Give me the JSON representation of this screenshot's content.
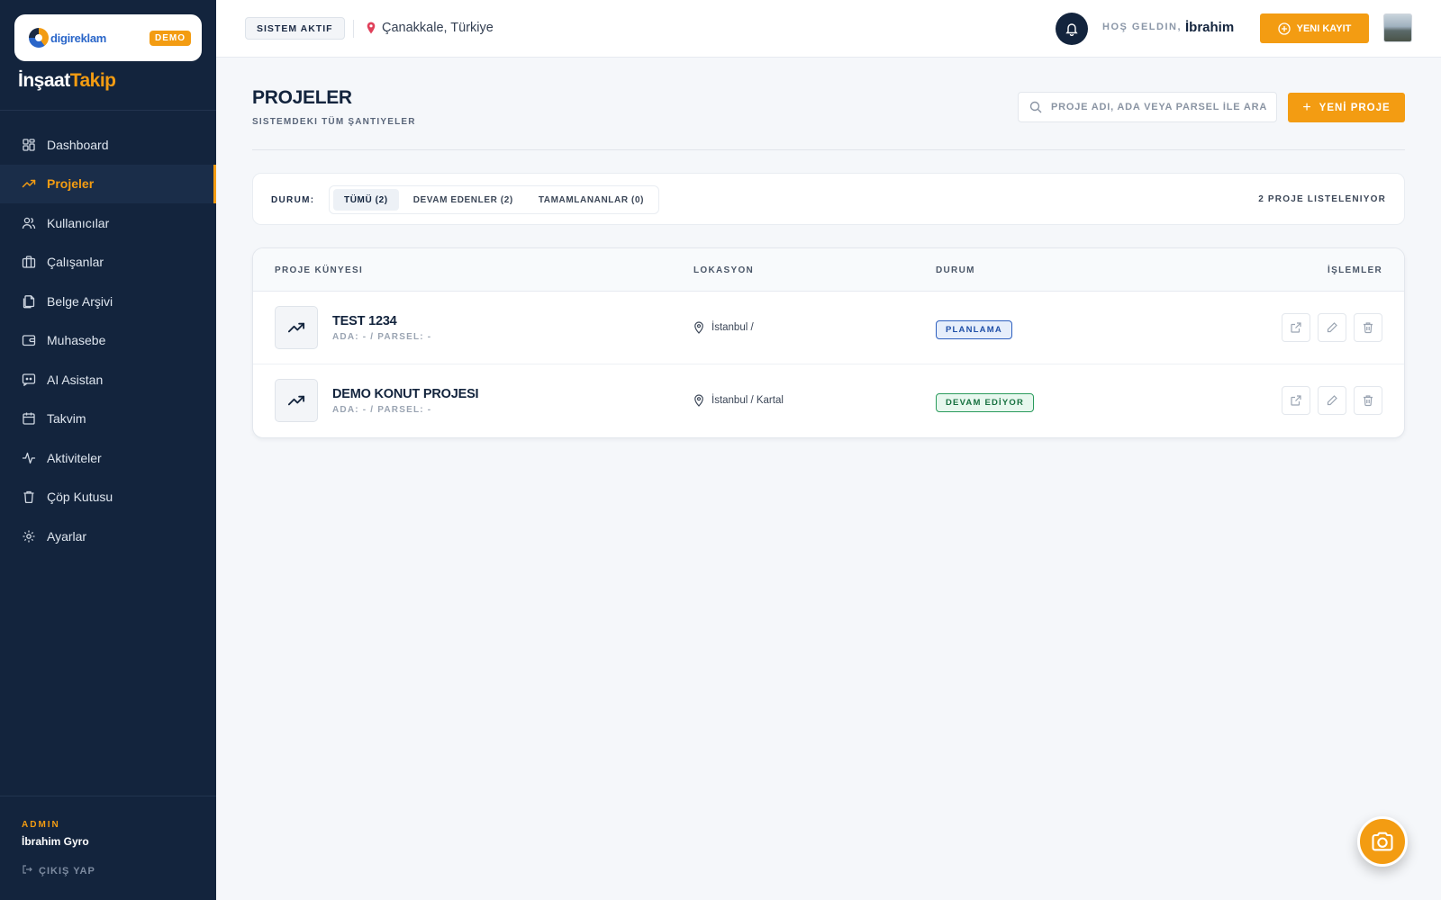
{
  "brand": {
    "logo_text": "digireklam",
    "badge": "DEMO",
    "app_name_part1": "İnşaat",
    "app_name_part2": "Takip"
  },
  "sidebar": {
    "items": [
      {
        "label": "Dashboard",
        "icon": "dashboard-icon",
        "active": false
      },
      {
        "label": "Projeler",
        "icon": "trending-up-icon",
        "active": true
      },
      {
        "label": "Kullanıcılar",
        "icon": "users-icon",
        "active": false
      },
      {
        "label": "Çalışanlar",
        "icon": "briefcase-icon",
        "active": false
      },
      {
        "label": "Belge Arşivi",
        "icon": "files-icon",
        "active": false
      },
      {
        "label": "Muhasebe",
        "icon": "wallet-icon",
        "active": false
      },
      {
        "label": "AI Asistan",
        "icon": "chat-bot-icon",
        "active": false
      },
      {
        "label": "Takvim",
        "icon": "calendar-icon",
        "active": false
      },
      {
        "label": "Aktiviteler",
        "icon": "activity-icon",
        "active": false
      },
      {
        "label": "Çöp Kutusu",
        "icon": "trash-icon",
        "active": false
      },
      {
        "label": "Ayarlar",
        "icon": "gear-icon",
        "active": false
      }
    ],
    "user_role": "ADMIN",
    "user_name": "İbrahim Gyro",
    "logout_label": "ÇIKIŞ YAP"
  },
  "topbar": {
    "system_status": "SISTEM AKTIF",
    "location": "Çanakkale, Türkiye",
    "welcome_label": "HOŞ GELDIN,",
    "welcome_name": "İbrahim",
    "new_record_label": "YENI KAYIT"
  },
  "page": {
    "title": "PROJELER",
    "subtitle": "SISTEMDEKI TÜM ŞANTIYELER",
    "search_placeholder": "PROJE ADI, ADA VEYA PARSEL İLE ARA",
    "new_project_label": "YENİ PROJE"
  },
  "filters": {
    "label": "DURUM:",
    "options": [
      "TÜMÜ (2)",
      "DEVAM EDENLER (2)",
      "TAMAMLANANLAR (0)"
    ],
    "selected": "TÜMÜ (2)",
    "listing_count": "2 PROJE LISTELENIYOR"
  },
  "table": {
    "headers": {
      "project": "PROJE KÜNYESI",
      "location": "LOKASYON",
      "status": "DURUM",
      "actions": "İŞLEMLER"
    },
    "rows": [
      {
        "name": "TEST 1234",
        "meta": "ADA: - / PARSEL: -",
        "location": "İstanbul /",
        "status": "PLANLAMA"
      },
      {
        "name": "DEMO KONUT PROJESI",
        "meta": "ADA: - / PARSEL: -",
        "location": "İstanbul / Kartal",
        "status": "DEVAM EDİYOR"
      }
    ]
  },
  "colors": {
    "accent": "#f39c12",
    "sidebar_bg": "#13243d",
    "status_plan": "#1f4fa8",
    "status_devam": "#16703f"
  }
}
